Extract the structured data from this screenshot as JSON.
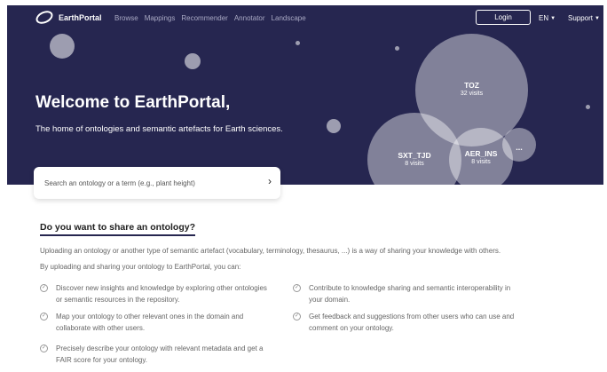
{
  "nav": {
    "logo_text": "EarthPortal",
    "links": [
      "Browse",
      "Mappings",
      "Recommender",
      "Annotator",
      "Landscape"
    ],
    "login_label": "Login",
    "language": "EN",
    "support": "Support"
  },
  "hero": {
    "title": "Welcome to EarthPortal,",
    "subtitle": "The home of ontologies and semantic artefacts for Earth sciences."
  },
  "bubbles": [
    {
      "name": "TOZ",
      "visits": "32 visits"
    },
    {
      "name": "SXT_TJD",
      "visits": "8 visits"
    },
    {
      "name": "AER_INS",
      "visits": "8 visits"
    },
    {
      "name": "..."
    }
  ],
  "search": {
    "placeholder": "Search an ontology or a term (e.g., plant height)"
  },
  "share": {
    "title": "Do you want to share an ontology?",
    "para1": "Uploading an ontology or another type of semantic artefact (vocabulary, terminology, thesaurus, ...) is a way of sharing your knowledge with others.",
    "para2": "By uploading and sharing your ontology to EarthPortal, you can:",
    "features": [
      "Discover new insights and knowledge by exploring other ontologies or semantic resources in the repository.",
      "Contribute to knowledge sharing and semantic interoperability in your domain.",
      "Map your ontology to other relevant ones in the domain and collaborate with other users.",
      "Get feedback and suggestions from other users who can use and comment on your ontology.",
      "Precisely describe your ontology with relevant metadata and get a FAIR score for your ontology."
    ]
  },
  "icons": {
    "check": "check-circle-icon",
    "chevron": "chevron-down-icon",
    "arrow": "chevron-right-icon"
  },
  "colors": {
    "hero_bg": "#262650",
    "accent": "#ffffff"
  }
}
